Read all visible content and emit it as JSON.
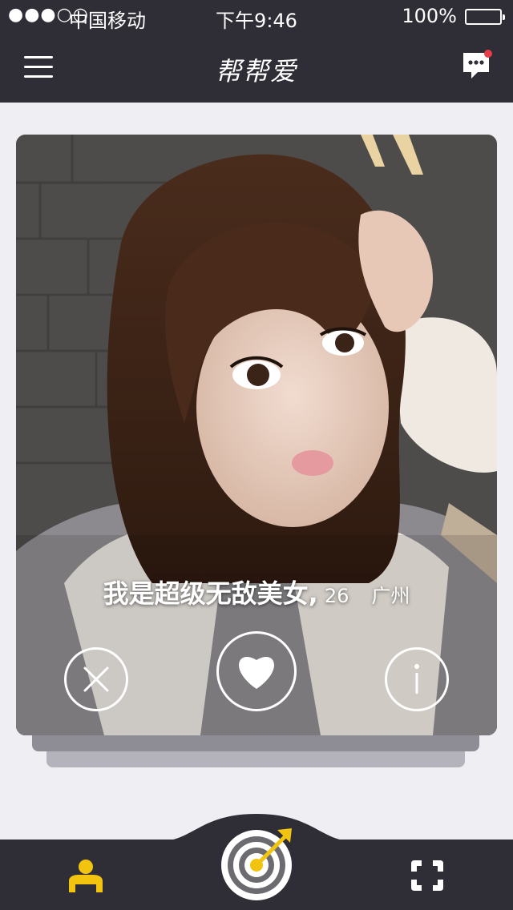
{
  "status_bar": {
    "signal": "●●●○○",
    "carrier": "中国移动",
    "time": "下午9:46",
    "battery": "100%"
  },
  "header": {
    "title": "帮帮爱",
    "menu_icon": "hamburger-menu-icon",
    "chat_icon": "chat-bubble-icon",
    "has_notification": true
  },
  "profile": {
    "name": "我是超级无敌美女,",
    "age": "26",
    "city": "广州"
  },
  "actions": {
    "dislike_icon": "close-x-icon",
    "like_icon": "heart-icon",
    "info_icon": "info-icon"
  },
  "tab_bar": {
    "items": [
      {
        "icon": "user-icon",
        "active": true
      },
      {
        "icon": "target-dart-icon",
        "active": false
      },
      {
        "icon": "scan-icon",
        "active": false
      }
    ]
  },
  "colors": {
    "bar_bg": "#2f2e36",
    "accent": "#f2c40f",
    "badge": "#e83d4a",
    "page_bg": "#eeeef3"
  }
}
